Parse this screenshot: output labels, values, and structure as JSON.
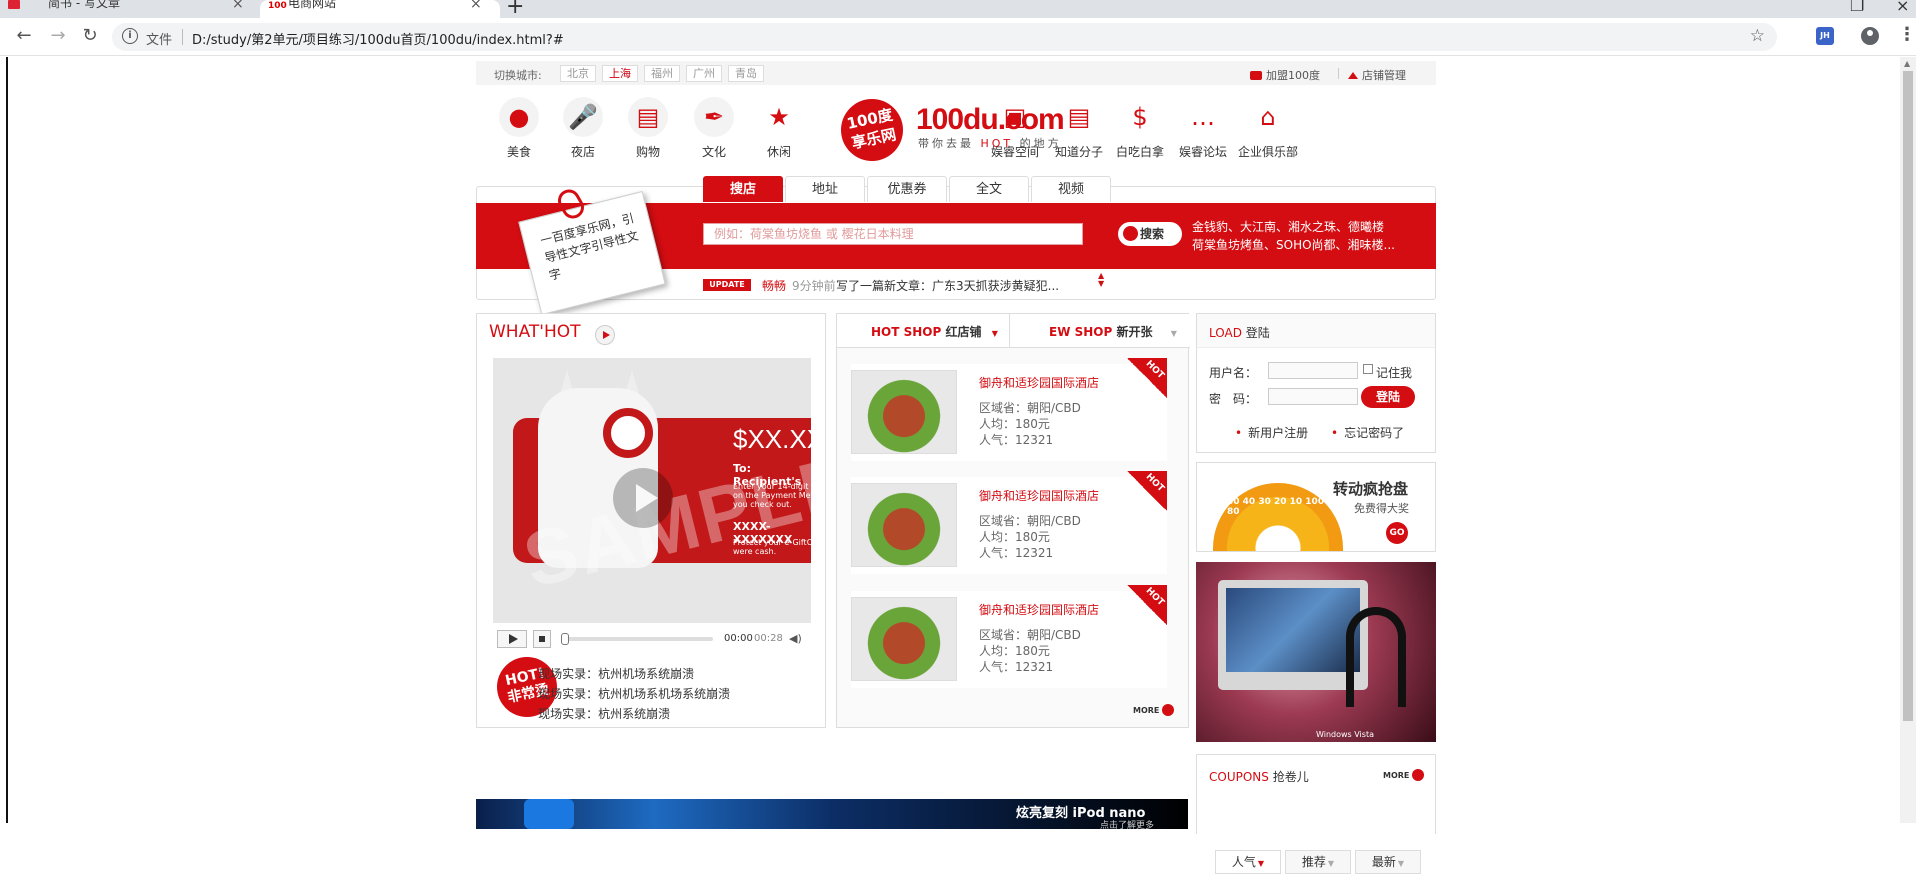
{
  "browser": {
    "tabs": [
      {
        "title": "简书 - 写文章"
      },
      {
        "title": "电商网站",
        "favicon": "100"
      }
    ],
    "address": {
      "scheme_label": "文件",
      "url": "D:/study/第2单元/项目练习/100du首页/100du/index.html?#"
    },
    "extension_label": "JH"
  },
  "city_bar": {
    "label": "切换城市:",
    "cities": [
      "北京",
      "上海",
      "福州",
      "广州",
      "青岛"
    ],
    "selected": "上海",
    "join": "加盟100度",
    "store_manage": "店铺管理"
  },
  "categories_left": [
    {
      "label": "美食",
      "icon": "piggy-bank-icon"
    },
    {
      "label": "夜店",
      "icon": "microphone-icon"
    },
    {
      "label": "购物",
      "icon": "shopping-bag-icon"
    },
    {
      "label": "文化",
      "icon": "pen-nib-icon"
    },
    {
      "label": "休闲",
      "icon": "star-icon"
    }
  ],
  "logo": {
    "badge": "100度\n享乐网",
    "text": "100du.com",
    "tagline_pre": "带你去最",
    "tagline_hot": "HOT",
    "tagline_post": "的地方"
  },
  "categories_right": [
    {
      "label": "娱睿空间",
      "icon": "briefcase-icon"
    },
    {
      "label": "知道分子",
      "icon": "chat-bubble-icon"
    },
    {
      "label": "白吃白拿",
      "icon": "money-bag-icon"
    },
    {
      "label": "娱睿论坛",
      "icon": "forum-icon"
    },
    {
      "label": "企业俱乐部",
      "icon": "building-icon"
    }
  ],
  "search": {
    "tabs": [
      "搜店",
      "地址",
      "优惠券",
      "全文",
      "视频"
    ],
    "active_tab": "搜店",
    "note": "一百度享乐网，引导性文字引导性文字",
    "placeholder": "例如：荷棠鱼坊烧鱼 或 樱花日本料理",
    "button": "搜索",
    "hot_words_line1": "金钱豹、大江南、湘水之珠、德曦楼",
    "hot_words_line2": "荷棠鱼坊烤鱼、SOHO尚都、湘味楼..."
  },
  "update": {
    "tag": "UPDATE",
    "user": "畅畅",
    "time": "9分钟前",
    "text": "写了一篇新文章：广东3天抓获涉黄疑犯..."
  },
  "whats_hot": {
    "title": "WHAT'HOT",
    "video": {
      "price": "$XX.XX",
      "to": "To: Recipient's",
      "fine": "Enter your 14-digit c on the Payment Met you check out.",
      "code": "XXXX-XXXXXXX",
      "protect": "Protect your e-GiftC were cash.",
      "watermark": "SAMPLE",
      "current_time": "00:00",
      "total_time": "00:28"
    },
    "badge": "HOT!\n非常烫",
    "items": [
      "现场实录：杭州机场系统崩溃",
      "现场实录：杭州机场系机场系统崩溃",
      "现场实录：杭州系统崩溃"
    ]
  },
  "shops": {
    "tabs": [
      {
        "en": "HOT SHOP",
        "zh": "红店铺"
      },
      {
        "en": "EW SHOP",
        "zh": "新开张"
      }
    ],
    "items": [
      {
        "name": "御舟和适珍园国际酒店",
        "area": "区域省：朝阳/CBD",
        "price": "人均：180元",
        "pop": "人气：12321",
        "tag": "HOT"
      },
      {
        "name": "御舟和适珍园国际酒店",
        "area": "区域省：朝阳/CBD",
        "price": "人均：180元",
        "pop": "人气：12321",
        "tag": "HOT"
      },
      {
        "name": "御舟和适珍园国际酒店",
        "area": "区域省：朝阳/CBD",
        "price": "人均：180元",
        "pop": "人气：12321",
        "tag": "HOT"
      }
    ],
    "more": "MORE"
  },
  "login": {
    "title_en": "LOAD",
    "title_zh": "登陆",
    "user_label": "用户名：",
    "pass_label": "密　码：",
    "remember": "记住我",
    "button": "登陆",
    "register": "新用户注册",
    "forgot": "忘记密码了"
  },
  "lottery": {
    "title": "转动疯抢盘",
    "subtitle": "免费得大奖",
    "go": "GO",
    "wheel_numbers": "50 40 30 20 10 100 90 80"
  },
  "laptop_ad": {
    "brand": "Windows Vista"
  },
  "ipod_ad": {
    "headline": "炫亮复刻  iPod nano",
    "sub": "点击了解更多"
  },
  "coupons": {
    "title_en": "COUPONS",
    "title_zh": "抢卷儿",
    "more": "MORE",
    "tabs": [
      "人气",
      "推荐",
      "最新"
    ]
  }
}
